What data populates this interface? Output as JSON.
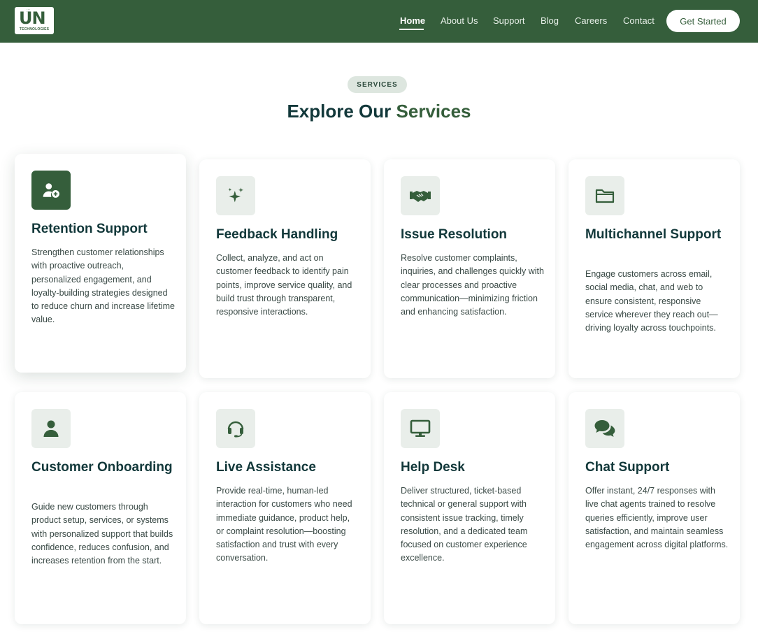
{
  "brand": {
    "logo_text": "UN",
    "logo_subtext": "TECHNOLOGIES"
  },
  "nav": {
    "items": [
      {
        "label": "Home",
        "active": true
      },
      {
        "label": "About Us"
      },
      {
        "label": "Support"
      },
      {
        "label": "Blog"
      },
      {
        "label": "Careers"
      },
      {
        "label": "Contact"
      }
    ],
    "cta_label": "Get Started"
  },
  "section": {
    "pill": "SERVICES",
    "heading_main": "Explore Our",
    "heading_accent": "Services"
  },
  "cards": [
    {
      "icon": "user-plus-icon",
      "title": "Retention Support",
      "description": "Strengthen customer relationships with proactive outreach, personalized engagement, and loyalty-building strategies designed to reduce churn and increase lifetime value."
    },
    {
      "icon": "sparkles-icon",
      "title": "Feedback Handling",
      "description": "Collect, analyze, and act on customer feedback to identify pain points, improve service quality, and build trust through transparent, responsive interactions."
    },
    {
      "icon": "handshake-icon",
      "title": "Issue Resolution",
      "description": "Resolve customer complaints, inquiries, and challenges quickly with clear processes and proactive communication—minimizing friction and enhancing satisfaction."
    },
    {
      "icon": "folder-icon",
      "title": "Multichannel Support",
      "description": "Engage customers across email, social media, chat, and web to ensure consistent, responsive service wherever they reach out—driving loyalty across touchpoints."
    },
    {
      "icon": "user-icon",
      "title": "Customer Onboarding",
      "description": "Guide new customers through product setup, services, or systems with personalized support that builds confidence, reduces confusion, and increases retention from the start."
    },
    {
      "icon": "headset-icon",
      "title": "Live Assistance",
      "description": "Provide real-time, human-led interaction for customers who need immediate guidance, product help, or complaint resolution—boosting satisfaction and trust with every conversation."
    },
    {
      "icon": "monitor-icon",
      "title": "Help Desk",
      "description": "Deliver structured, ticket-based technical or general support with consistent issue tracking, timely resolution, and a dedicated team focused on customer experience excellence."
    },
    {
      "icon": "chat-bubbles-icon",
      "title": "Chat Support",
      "description": "Offer instant, 24/7 responses with live chat agents trained to resolve queries efficiently, improve user satisfaction, and maintain seamless engagement across digital platforms."
    }
  ],
  "colors": {
    "brand_green": "#355e3b",
    "heading": "#12383a",
    "icon_bg": "#e9eeea"
  }
}
